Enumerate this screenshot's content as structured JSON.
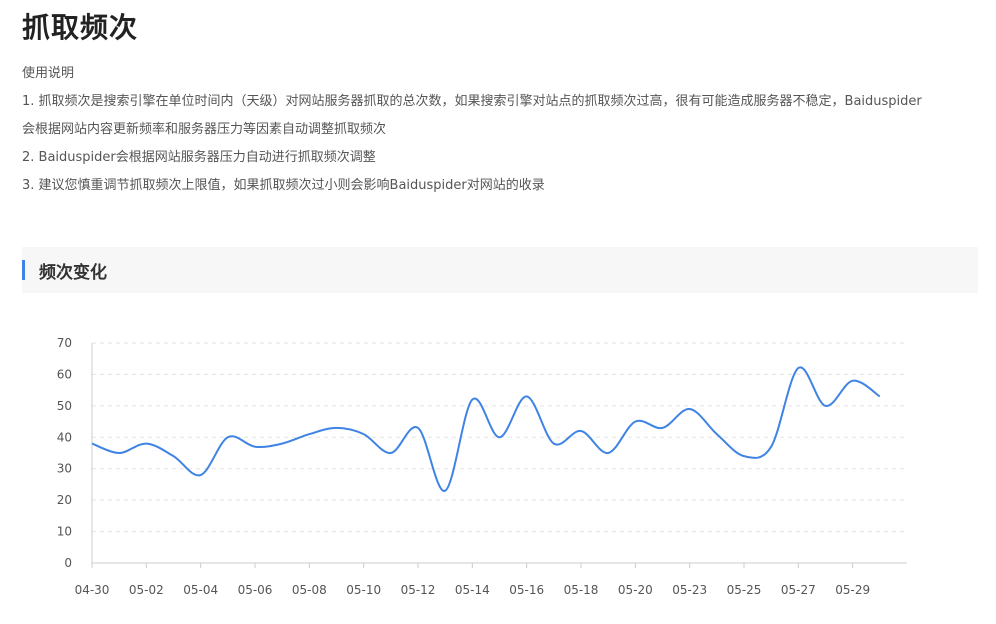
{
  "page": {
    "title": "抓取频次"
  },
  "usage": {
    "heading": "使用说明",
    "line1": "1. 抓取频次是搜索引擎在单位时间内（天级）对网站服务器抓取的总次数，如果搜索引擎对站点的抓取频次过高，很有可能造成服务器不稳定，Baiduspider",
    "line1b": "会根据网站内容更新频率和服务器压力等因素自动调整抓取频次",
    "line2": "2. Baiduspider会根据网站服务器压力自动进行抓取频次调整",
    "line3": "3. 建议您慎重调节抓取频次上限值，如果抓取频次过小则会影响Baiduspider对网站的收录"
  },
  "section": {
    "title": "频次变化"
  },
  "colors": {
    "accent": "#3d84e6",
    "line": "#3f83e4",
    "grid": "#e3e3e3"
  },
  "chart_data": {
    "type": "line",
    "x": [
      "04-30",
      "05-01",
      "05-02",
      "05-03",
      "05-04",
      "05-05",
      "05-06",
      "05-07",
      "05-08",
      "05-09",
      "05-10",
      "05-11",
      "05-12",
      "05-13",
      "05-14",
      "05-15",
      "05-16",
      "05-17",
      "05-18",
      "05-19",
      "05-20",
      "05-21",
      "05-22",
      "05-23",
      "05-24",
      "05-25",
      "05-26",
      "05-27",
      "05-28",
      "05-29",
      "05-30"
    ],
    "tick_labels": [
      "04-30",
      "05-02",
      "05-04",
      "05-06",
      "05-08",
      "05-10",
      "05-12",
      "05-14",
      "05-16",
      "05-18",
      "05-20",
      "05-23",
      "05-25",
      "05-27",
      "05-29"
    ],
    "tick_indices": [
      0,
      2,
      4,
      6,
      8,
      10,
      12,
      14,
      16,
      18,
      20,
      22,
      24,
      26,
      28
    ],
    "series": [
      {
        "values": [
          38,
          35,
          38,
          34,
          28,
          40,
          37,
          38,
          41,
          43,
          41,
          35,
          43,
          23,
          52,
          40,
          53,
          38,
          42,
          35,
          45,
          43,
          49,
          41,
          34,
          37,
          62,
          50,
          58,
          53
        ]
      }
    ],
    "ylim": [
      0,
      70
    ],
    "yticks": [
      0,
      10,
      20,
      30,
      40,
      50,
      60,
      70
    ],
    "grid": true,
    "legend": "none"
  }
}
